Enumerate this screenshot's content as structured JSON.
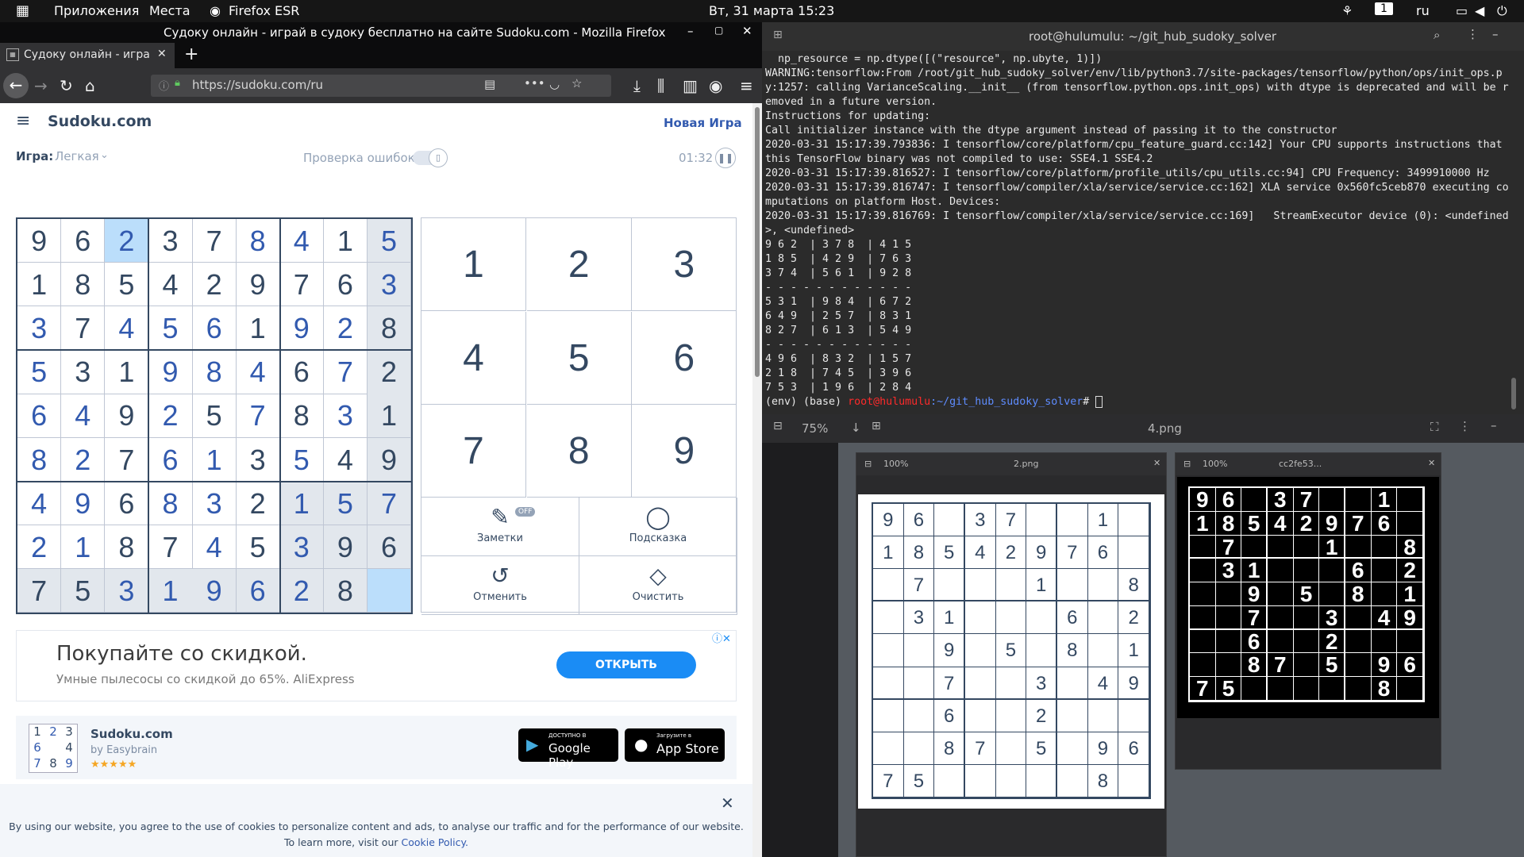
{
  "topbar": {
    "apps": "Приложения",
    "places": "Места",
    "browser": "Firefox ESR",
    "datetime": "Вт, 31 марта  15:23",
    "workspace": "1",
    "lang": "ru"
  },
  "firefox": {
    "window_title": "Судоку онлайн - играй в судоку бесплатно на сайте Sudoku.com - Mozilla Firefox",
    "tab_title": "Судоку онлайн - играй в",
    "url": "https://sudoku.com/ru"
  },
  "site": {
    "logo": "Sudoku.com",
    "new_game": "Новая Игра",
    "game_label": "Игра:",
    "difficulty": "Легкая",
    "error_check": "Проверка ошибок",
    "timer": "01:32",
    "board": [
      [
        "9",
        "6",
        "2",
        "3",
        "7",
        "8",
        "4",
        "1",
        "5"
      ],
      [
        "1",
        "8",
        "5",
        "4",
        "2",
        "9",
        "7",
        "6",
        "3"
      ],
      [
        "3",
        "7",
        "4",
        "5",
        "6",
        "1",
        "9",
        "2",
        "8"
      ],
      [
        "5",
        "3",
        "1",
        "9",
        "8",
        "4",
        "6",
        "7",
        "2"
      ],
      [
        "6",
        "4",
        "9",
        "2",
        "5",
        "7",
        "8",
        "3",
        "1"
      ],
      [
        "8",
        "2",
        "7",
        "6",
        "1",
        "3",
        "5",
        "4",
        "9"
      ],
      [
        "4",
        "9",
        "6",
        "8",
        "3",
        "2",
        "1",
        "5",
        "7"
      ],
      [
        "2",
        "1",
        "8",
        "7",
        "4",
        "5",
        "3",
        "9",
        "6"
      ],
      [
        "7",
        "5",
        "3",
        "1",
        "9",
        "6",
        "2",
        "8",
        ""
      ]
    ],
    "given": [
      [
        1,
        1,
        0,
        1,
        1,
        0,
        0,
        1,
        0
      ],
      [
        1,
        1,
        1,
        1,
        1,
        1,
        1,
        1,
        0
      ],
      [
        0,
        1,
        0,
        0,
        0,
        1,
        0,
        0,
        1
      ],
      [
        0,
        1,
        1,
        0,
        0,
        0,
        1,
        0,
        1
      ],
      [
        0,
        0,
        1,
        0,
        1,
        0,
        1,
        0,
        1
      ],
      [
        0,
        0,
        1,
        0,
        0,
        1,
        0,
        1,
        1
      ],
      [
        0,
        0,
        1,
        0,
        0,
        1,
        0,
        0,
        0
      ],
      [
        0,
        0,
        1,
        1,
        0,
        1,
        0,
        1,
        1
      ],
      [
        1,
        1,
        0,
        0,
        0,
        0,
        0,
        1,
        0
      ]
    ],
    "numpad": [
      "1",
      "2",
      "3",
      "4",
      "5",
      "6",
      "7",
      "8",
      "9"
    ],
    "tools": {
      "notes": "Заметки",
      "notes_badge": "OFF",
      "hint": "Подсказка",
      "undo": "Отменить",
      "erase": "Очистить"
    },
    "ad": {
      "title": "Покупайте со скидкой.",
      "subtitle": "Умные пылесосы со скидкой до 65%. AliExpress",
      "button": "ОТКРЫТЬ"
    },
    "app": {
      "name": "Sudoku.com",
      "by": "by Easybrain",
      "stars": "★★★★★",
      "gp_small": "ДОСТУПНО В",
      "gp": "Google Play",
      "as_small": "Загрузите в",
      "as": "App Store",
      "icon_digits": [
        "1",
        "2",
        "3",
        "6",
        "",
        "4",
        "7",
        "8",
        "9"
      ]
    },
    "cookie": {
      "line1": "By using our website, you agree to the use of cookies to personalize content and ads, to analyse our traffic and for the performance of our website.",
      "line2": "To learn more, visit our ",
      "link": "Cookie Policy."
    }
  },
  "terminal": {
    "title": "root@hulumulu: ~/git_hub_sudoky_solver",
    "lines": [
      "  np_resource = np.dtype([(\"resource\", np.ubyte, 1)])",
      "WARNING:tensorflow:From /root/git_hub_sudoky_solver/env/lib/python3.7/site-packages/tensorflow/python/ops/init_ops.py:1257: calling VarianceScaling.__init__ (from tensorflow.python.ops.init_ops) with dtype is deprecated and will be removed in a future version.",
      "Instructions for updating:",
      "Call initializer instance with the dtype argument instead of passing it to the constructor",
      "2020-03-31 15:17:39.793836: I tensorflow/core/platform/cpu_feature_guard.cc:142] Your CPU supports instructions that this TensorFlow binary was not compiled to use: SSE4.1 SSE4.2",
      "2020-03-31 15:17:39.816527: I tensorflow/core/platform/profile_utils/cpu_utils.cc:94] CPU Frequency: 3499910000 Hz",
      "2020-03-31 15:17:39.816747: I tensorflow/compiler/xla/service/service.cc:162] XLA service 0x560fc5ceb870 executing computations on platform Host. Devices:",
      "2020-03-31 15:17:39.816769: I tensorflow/compiler/xla/service/service.cc:169]   StreamExecutor device (0): <undefined>, <undefined>",
      "9 6 2  | 3 7 8  | 4 1 5",
      "1 8 5  | 4 2 9  | 7 6 3",
      "3 7 4  | 5 6 1  | 9 2 8",
      "- - - - - - - - - - - -",
      "5 3 1  | 9 8 4  | 6 7 2",
      "6 4 9  | 2 5 7  | 8 3 1",
      "8 2 7  | 6 1 3  | 5 4 9",
      "- - - - - - - - - - - -",
      "4 9 6  | 8 3 2  | 1 5 7",
      "2 1 8  | 7 4 5  | 3 9 6",
      "7 5 3  | 1 9 6  | 2 8 4"
    ],
    "prompt_env": "(env) (base) ",
    "prompt_user": "root@hulumulu",
    "prompt_path": ":~/git_hub_sudoky_solver",
    "prompt_end": "# "
  },
  "viewer": {
    "zoom": "75%",
    "title": "4.png",
    "win1": {
      "zoom": "100%",
      "title": "2.png",
      "grid": [
        [
          "9",
          "6",
          "",
          "3",
          "7",
          "",
          "",
          "1",
          ""
        ],
        [
          "1",
          "8",
          "5",
          "4",
          "2",
          "9",
          "7",
          "6",
          ""
        ],
        [
          "",
          "7",
          "",
          "",
          "",
          "1",
          "",
          "",
          "8"
        ],
        [
          "",
          "3",
          "1",
          "",
          "",
          "",
          "6",
          "",
          "2"
        ],
        [
          "",
          "",
          "9",
          "",
          "5",
          "",
          "8",
          "",
          "1"
        ],
        [
          "",
          "",
          "7",
          "",
          "",
          "3",
          "",
          "4",
          "9"
        ],
        [
          "",
          "",
          "6",
          "",
          "",
          "2",
          "",
          "",
          ""
        ],
        [
          "",
          "",
          "8",
          "7",
          "",
          "5",
          "",
          "9",
          "6"
        ],
        [
          "7",
          "5",
          "",
          "",
          "",
          "",
          "",
          "8",
          ""
        ]
      ]
    },
    "win2": {
      "zoom": "100%",
      "title": "cc2fe53...",
      "grid": [
        [
          "9",
          "6",
          "",
          "3",
          "7",
          "",
          "",
          "1",
          ""
        ],
        [
          "1",
          "8",
          "5",
          "4",
          "2",
          "9",
          "7",
          "6",
          ""
        ],
        [
          "",
          "7",
          "",
          "",
          "",
          "1",
          "",
          "",
          "8"
        ],
        [
          "",
          "3",
          "1",
          "",
          "",
          "",
          "6",
          "",
          "2"
        ],
        [
          "",
          "",
          "9",
          "",
          "5",
          "",
          "8",
          "",
          "1"
        ],
        [
          "",
          "",
          "7",
          "",
          "",
          "3",
          "",
          "4",
          "9"
        ],
        [
          "",
          "",
          "6",
          "",
          "",
          "2",
          "",
          "",
          ""
        ],
        [
          "",
          "",
          "8",
          "7",
          "",
          "5",
          "",
          "9",
          "6"
        ],
        [
          "7",
          "5",
          "",
          "",
          "",
          "",
          "",
          "8",
          ""
        ]
      ]
    }
  }
}
